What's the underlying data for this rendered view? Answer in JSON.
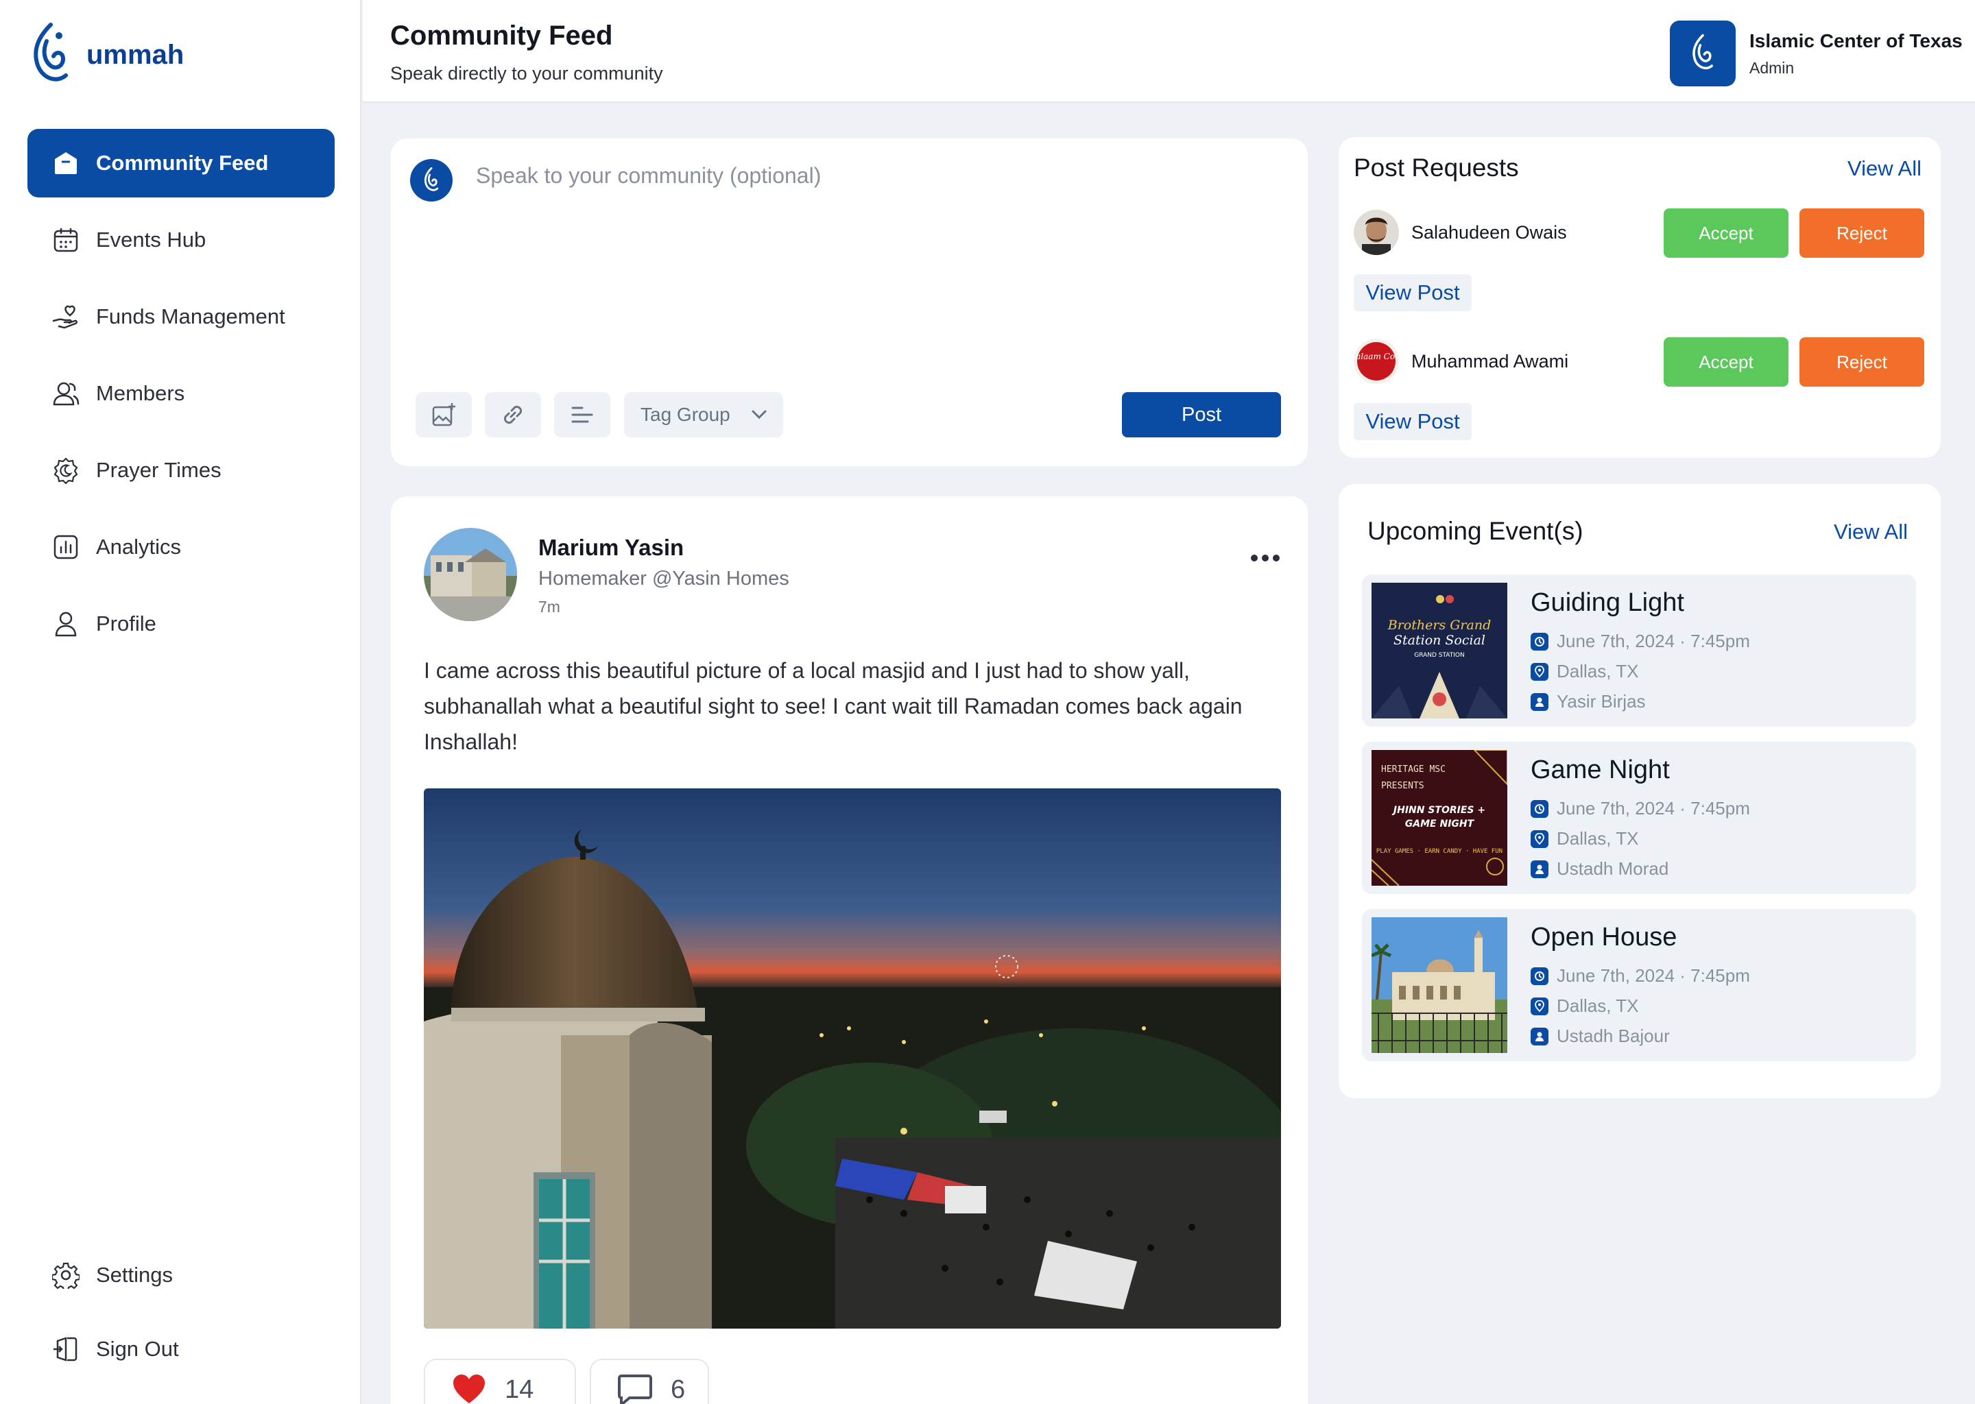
{
  "app": {
    "logo_text": "ummah"
  },
  "colors": {
    "brand": "#0a4ba3",
    "accept": "#5ac85a",
    "reject": "#f26f2a",
    "background": "#eef1f6"
  },
  "sidebar": {
    "items": [
      {
        "label": "Community Feed",
        "icon": "home-icon",
        "active": true
      },
      {
        "label": "Events Hub",
        "icon": "calendar-icon"
      },
      {
        "label": "Funds Management",
        "icon": "hand-heart-icon"
      },
      {
        "label": "Members",
        "icon": "members-icon"
      },
      {
        "label": "Prayer Times",
        "icon": "crescent-badge-icon"
      },
      {
        "label": "Analytics",
        "icon": "analytics-icon"
      },
      {
        "label": "Profile",
        "icon": "user-icon"
      }
    ],
    "bottom": [
      {
        "label": "Settings",
        "icon": "gear-icon"
      },
      {
        "label": "Sign Out",
        "icon": "sign-out-icon"
      }
    ]
  },
  "header": {
    "title": "Community Feed",
    "subtitle": "Speak directly to your community",
    "org_name": "Islamic Center of Texas",
    "org_role": "Admin"
  },
  "composer": {
    "placeholder": "Speak to your community (optional)",
    "tag_group": "Tag Group",
    "post_label": "Post"
  },
  "post": {
    "author": "Marium Yasin",
    "role": "Homemaker @Yasin Homes",
    "time": "7m",
    "text": "I came across this beautiful picture of a local masjid and I just had to show yall, subhanallah what a beautiful sight to see!  I cant wait till Ramadan comes back again Inshallah!",
    "likes": "14",
    "comments": "6"
  },
  "requests": {
    "title": "Post Requests",
    "view_all": "View All",
    "items": [
      {
        "name": "Salahudeen Owais",
        "accept": "Accept",
        "reject": "Reject",
        "view": "View Post"
      },
      {
        "name": "Muhammad Awami",
        "accept": "Accept",
        "reject": "Reject",
        "view": "View Post",
        "avatar_text": "Salaam Cola"
      }
    ]
  },
  "events": {
    "title": "Upcoming Event(s)",
    "view_all": "View All",
    "items": [
      {
        "title": "Guiding Light",
        "datetime": "June 7th, 2024 · 7:45pm",
        "location": "Dallas, TX",
        "host": "Yasir Birjas",
        "poster_text": [
          "Brothers Grand",
          "Station Social",
          "GRAND STATION"
        ]
      },
      {
        "title": "Game Night",
        "datetime": "June 7th, 2024 · 7:45pm",
        "location": "Dallas, TX",
        "host": "Ustadh Morad",
        "poster_text": [
          "HERITAGE MSC",
          "PRESENTS",
          "JHINN STORIES +",
          "GAME NIGHT",
          "PLAY GAMES · EARN CANDY · HAVE FUN"
        ]
      },
      {
        "title": "Open House",
        "datetime": "June 7th, 2024 · 7:45pm",
        "location": "Dallas, TX",
        "host": "Ustadh Bajour"
      }
    ]
  }
}
